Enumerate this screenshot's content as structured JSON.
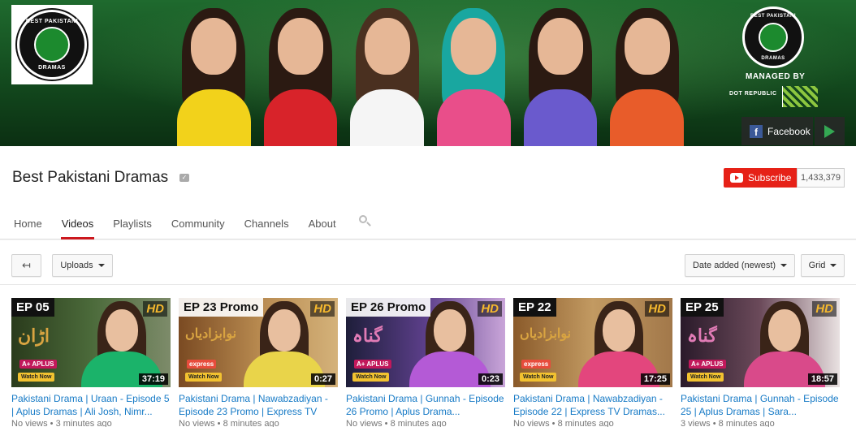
{
  "banner": {
    "logo_text_top": "BEST PAKISTANI",
    "logo_text_bottom": "DRAMAS",
    "managed_by": "MANAGED BY",
    "partner": "DOT REPUBLIC",
    "facebook_label": "Facebook",
    "icons": [
      "facebook-icon",
      "google-play-icon"
    ]
  },
  "channel": {
    "name": "Best Pakistani Dramas",
    "verified_icon": "verified-icon",
    "subscribe_label": "Subscribe",
    "subscriber_count": "1,433,379"
  },
  "tabs": [
    {
      "label": "Home",
      "active": false
    },
    {
      "label": "Videos",
      "active": true
    },
    {
      "label": "Playlists",
      "active": false
    },
    {
      "label": "Community",
      "active": false
    },
    {
      "label": "Channels",
      "active": false
    },
    {
      "label": "About",
      "active": false
    }
  ],
  "controls": {
    "back_icon": "back-arrow-icon",
    "uploads_label": "Uploads",
    "sort_label": "Date added (newest)",
    "view_label": "Grid"
  },
  "videos": [
    {
      "ep_label": "EP 05",
      "show_logo": "اڑان",
      "network": "A+ APLUS",
      "badge": "HD",
      "watch_label": "Watch Now",
      "duration": "37:19",
      "title": "Pakistani Drama | Uraan - Episode 5 | Aplus Dramas | Ali Josh, Nimr...",
      "views": "No views",
      "age": "3 minutes ago"
    },
    {
      "ep_label": "EP 23 Promo",
      "show_logo": "نوابزادیاں",
      "network": "express",
      "badge": "HD",
      "watch_label": "Watch Now",
      "duration": "0:27",
      "title": "Pakistani Drama | Nawabzadiyan - Episode 23 Promo | Express TV",
      "views": "No views",
      "age": "8 minutes ago"
    },
    {
      "ep_label": "EP 26 Promo",
      "show_logo": "گناہ",
      "network": "A+ APLUS",
      "badge": "HD",
      "watch_label": "Watch Now",
      "duration": "0:23",
      "title": "Pakistani Drama | Gunnah - Episode 26 Promo | Aplus Drama...",
      "views": "No views",
      "age": "8 minutes ago"
    },
    {
      "ep_label": "EP 22",
      "show_logo": "نوابزادیاں",
      "network": "express",
      "badge": "HD",
      "watch_label": "Watch Now",
      "duration": "17:25",
      "title": "Pakistani Drama | Nawabzadiyan - Episode 22 | Express TV Dramas...",
      "views": "No views",
      "age": "8 minutes ago"
    },
    {
      "ep_label": "EP 25",
      "show_logo": "گناہ",
      "network": "A+ APLUS",
      "badge": "HD",
      "watch_label": "Watch Now",
      "duration": "18:57",
      "title": "Pakistani Drama | Gunnah - Episode 25 | Aplus Dramas | Sara...",
      "views": "3 views",
      "age": "8 minutes ago"
    }
  ],
  "colors": {
    "accent_red": "#cc181e",
    "subscribe_red": "#e62117",
    "link_blue": "#167ac6",
    "banner_green": "#1f6a2e"
  }
}
